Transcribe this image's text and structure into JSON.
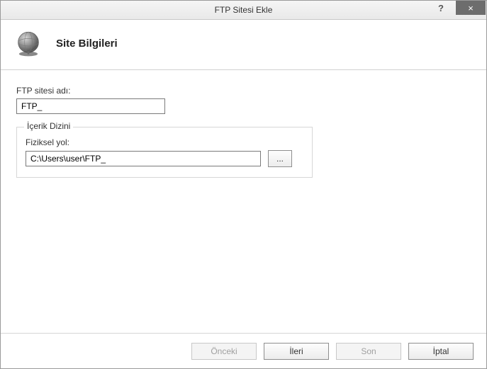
{
  "window": {
    "title": "FTP Sitesi Ekle",
    "help_glyph": "?",
    "close_glyph": "×"
  },
  "header": {
    "title": "Site Bilgileri"
  },
  "form": {
    "site_name_label": "FTP sitesi adı:",
    "site_name_value": "FTP_",
    "content_dir_group": "İçerik Dizini",
    "physical_path_label": "Fiziksel yol:",
    "physical_path_value": "C:\\Users\\user\\FTP_",
    "browse_label": "..."
  },
  "footer": {
    "previous": "Önceki",
    "next": "İleri",
    "finish": "Son",
    "cancel": "İptal"
  }
}
